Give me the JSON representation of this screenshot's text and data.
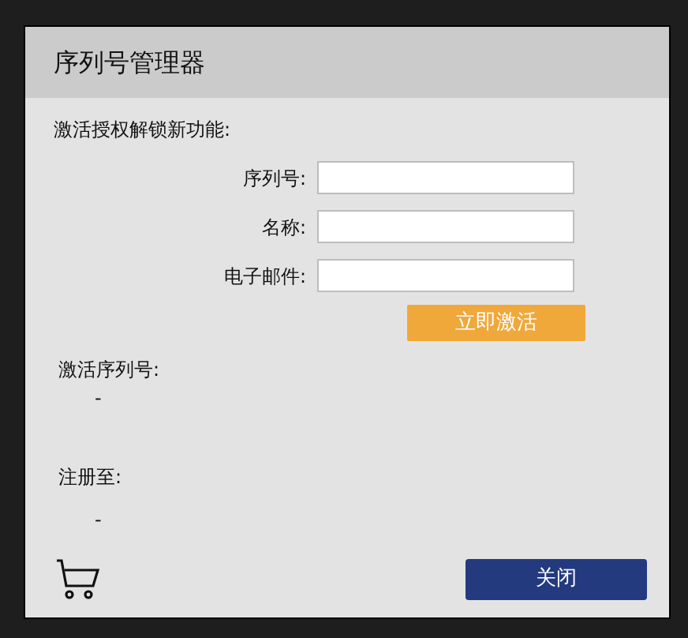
{
  "dialog": {
    "title": "序列号管理器"
  },
  "intro": "激活授权解锁新功能:",
  "fields": [
    {
      "label": "序列号:"
    },
    {
      "label": "名称:"
    },
    {
      "label": "电子邮件:"
    }
  ],
  "activate_button": "立即激活",
  "serial": {
    "label": "激活序列号:",
    "value": "-"
  },
  "registered_to": {
    "label": "注册至:",
    "value": "-"
  },
  "close_button": "关闭"
}
